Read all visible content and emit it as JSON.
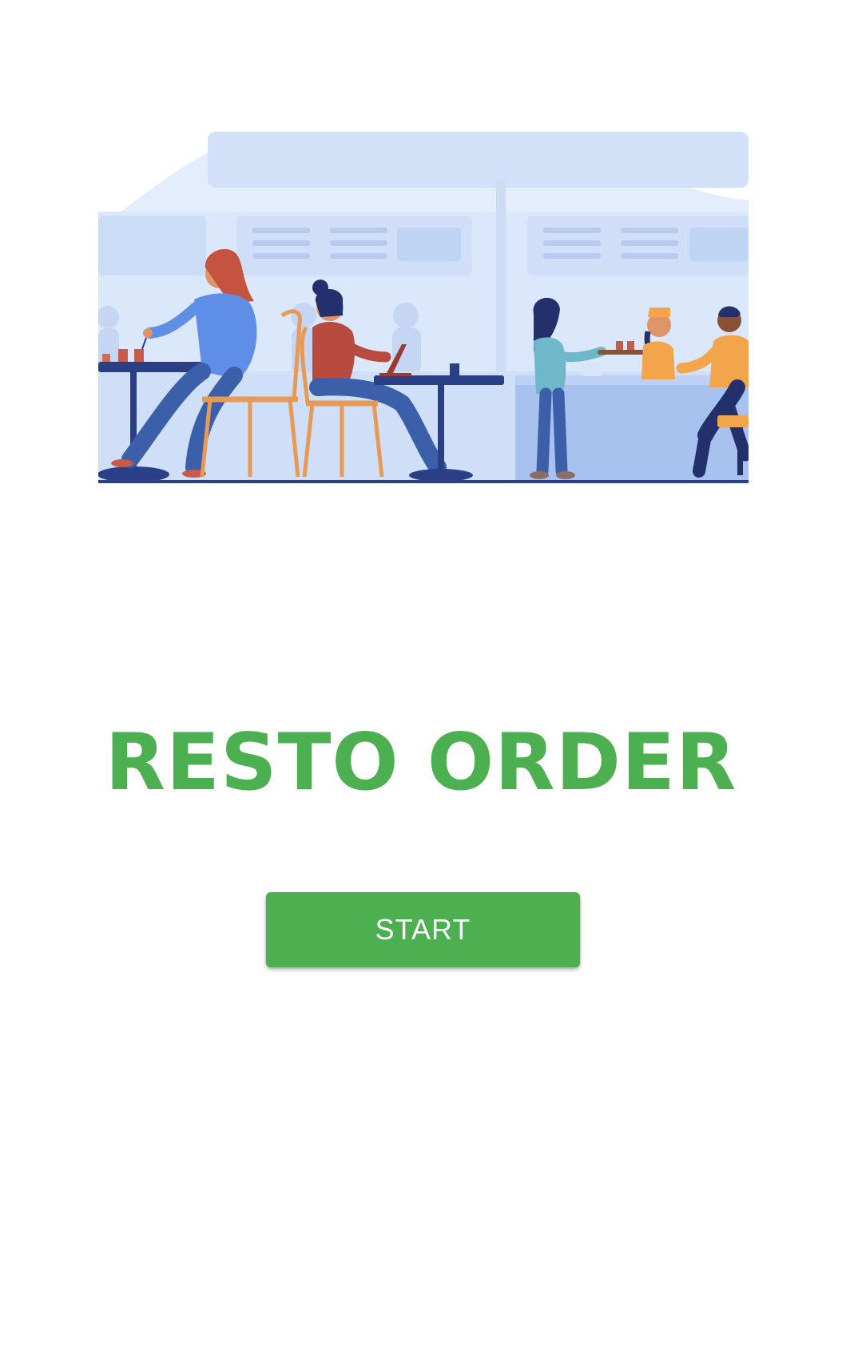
{
  "app": {
    "title": "RESTO ORDER",
    "accent_color": "#4caf50"
  },
  "hero": {
    "image": "restaurant-illustration"
  },
  "actions": {
    "start_label": "START"
  }
}
